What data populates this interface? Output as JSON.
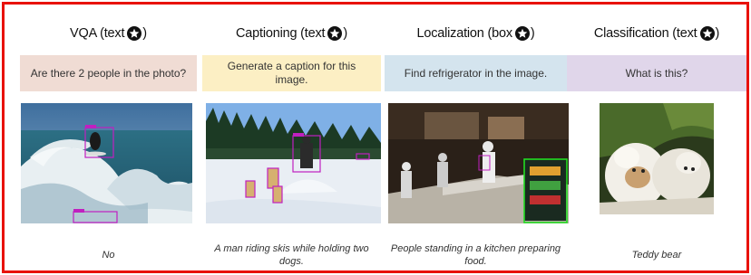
{
  "columns": [
    {
      "title": "VQA (text",
      "title_suffix": ")",
      "prompt": "Are there 2 people in the photo?",
      "answer": "No",
      "prompt_color": "#f0dcd4",
      "image": "surfer-on-wave-with-detection-boxes"
    },
    {
      "title": "Captioning (text",
      "title_suffix": ")",
      "prompt": "Generate a caption for this image.",
      "answer": "A man riding skis while holding two dogs.",
      "prompt_color": "#fcefc4",
      "image": "skier-with-dogs-in-snow-with-detection-boxes"
    },
    {
      "title": "Localization (box",
      "title_suffix": ")",
      "prompt": "Find refrigerator in the image.",
      "answer": "People standing in a kitchen preparing food.",
      "prompt_color": "#d4e4ee",
      "image": "restaurant-kitchen-with-refrigerator-box"
    },
    {
      "title": "Classification (text",
      "title_suffix": ")",
      "prompt": "What is this?",
      "answer": "Teddy bear",
      "prompt_color": "#e0d6ea",
      "image": "teddy-bears-photo"
    }
  ],
  "frame_color": "#e8120c",
  "box_color_detection": "#c020c0",
  "box_color_localization": "#22dd22",
  "icon": "star-in-circle-icon"
}
